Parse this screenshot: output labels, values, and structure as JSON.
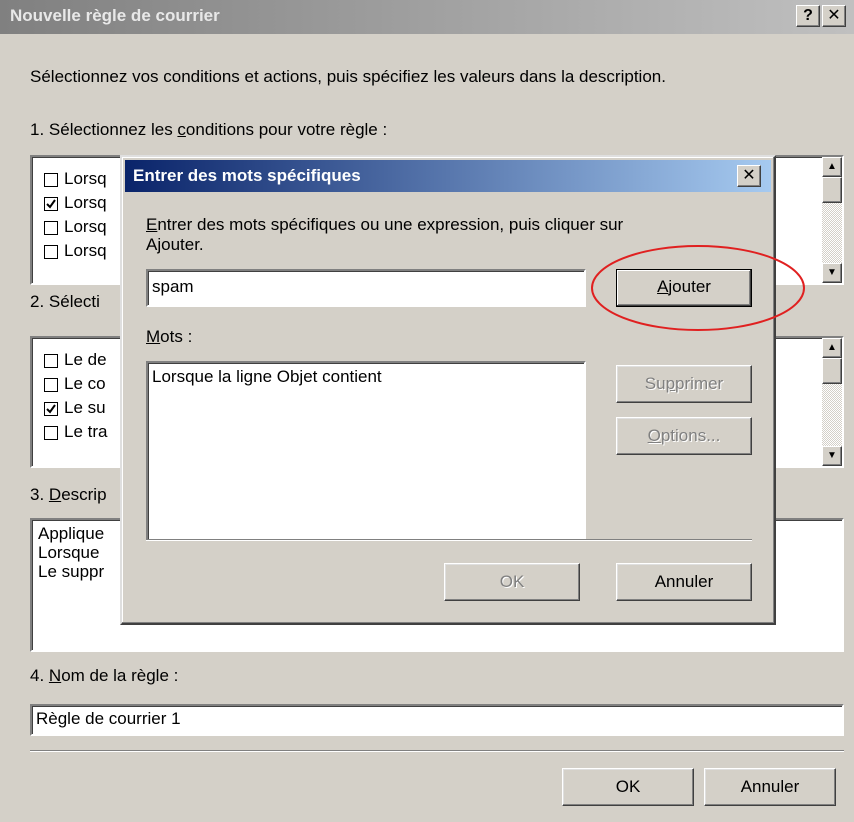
{
  "window": {
    "title": "Nouvelle règle de courrier",
    "help_btn": "?",
    "close_btn": "✕",
    "intro": "Sélectionnez vos conditions et actions, puis spécifiez les valeurs dans la description.",
    "step1": {
      "pre": "1. Sélectionnez les ",
      "key": "c",
      "post": "onditions pour votre règle :"
    },
    "conditions": [
      {
        "label": "Lorsq",
        "checked": false
      },
      {
        "label": "Lorsq",
        "checked": true
      },
      {
        "label": "Lorsq",
        "checked": false
      },
      {
        "label": "Lorsq",
        "checked": false
      }
    ],
    "step2": "2. Sélecti",
    "actions": [
      {
        "label": "Le de",
        "checked": false
      },
      {
        "label": "Le co",
        "checked": false
      },
      {
        "label": "Le su",
        "checked": true
      },
      {
        "label": "Le tra",
        "checked": false
      }
    ],
    "step3": {
      "pre": "3. ",
      "key": "D",
      "post": "escrip"
    },
    "description_lines": [
      "Applique",
      "Lorsque",
      "Le suppr"
    ],
    "step4": {
      "pre": "4. ",
      "key": "N",
      "post": "om de la règle :"
    },
    "rule_name": "Règle de courrier 1",
    "ok_label": "OK",
    "cancel_label": "Annuler"
  },
  "dialog": {
    "title": "Entrer des mots spécifiques",
    "close_btn": "✕",
    "instruction": {
      "key": "E",
      "line1_rest": "ntrer des mots spécifiques ou une expression, puis cliquer sur",
      "line2": "Ajouter."
    },
    "input_value": "spam",
    "add_button": {
      "key": "A",
      "rest": "jouter"
    },
    "words_label": {
      "key": "M",
      "rest": "ots :"
    },
    "words_list": [
      "Lorsque la ligne Objet contient"
    ],
    "remove_button": {
      "pre": "Su",
      "key": "p",
      "post": "primer"
    },
    "options_button": {
      "key": "O",
      "rest": "ptions..."
    },
    "ok_label": "OK",
    "cancel_label": "Annuler"
  },
  "colors": {
    "dialog_title_start": "#0a246a",
    "dialog_title_end": "#a6caf0",
    "annotation_circle": "#e02020"
  }
}
